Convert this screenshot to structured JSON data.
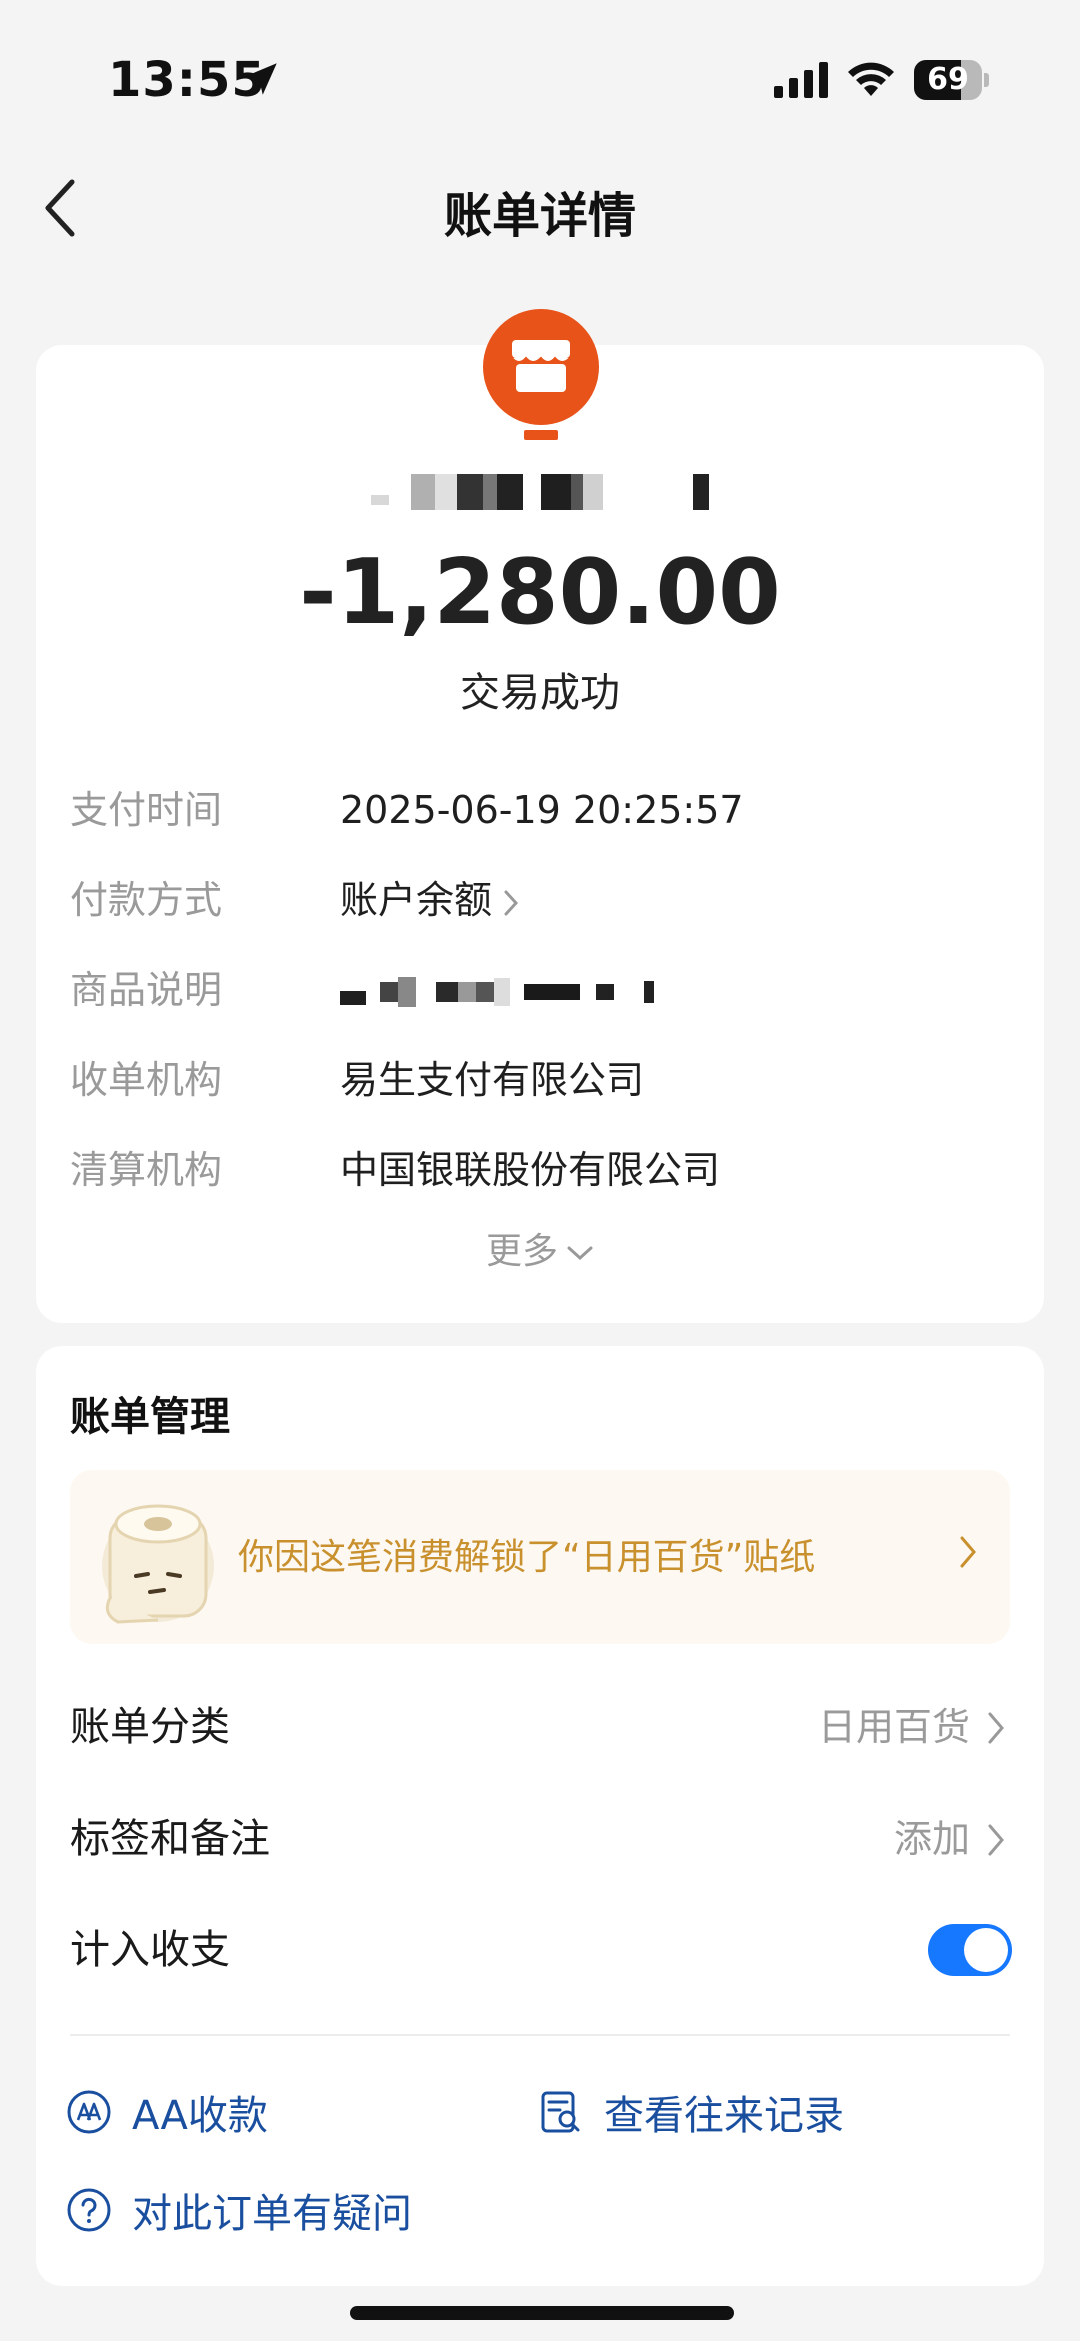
{
  "status_bar": {
    "time": "13:55",
    "battery": "69",
    "battery_level": 0.69
  },
  "nav": {
    "title": "账单详情"
  },
  "merchant": {
    "icon": "shop-icon",
    "brand_color": "#e8531a"
  },
  "transaction": {
    "amount": "-1,280.00",
    "status": "交易成功"
  },
  "details": [
    {
      "label": "支付时间",
      "value": "2025-06-19 20:25:57"
    },
    {
      "label": "付款方式",
      "value": "账户余额"
    },
    {
      "label": "商品说明",
      "value": ""
    },
    {
      "label": "收单机构",
      "value": "易生支付有限公司"
    },
    {
      "label": "清算机构",
      "value": "中国银联股份有限公司"
    }
  ],
  "more": {
    "label": "更多"
  },
  "management": {
    "title": "账单管理",
    "sticker_banner": {
      "text": "你因这笔消费解锁了“日用百货”贴纸"
    },
    "category": {
      "label": "账单分类",
      "value": "日用百货"
    },
    "tags": {
      "label": "标签和备注",
      "value": "添加"
    },
    "include_in_stats": {
      "label": "计入收支",
      "enabled": true
    },
    "actions": {
      "aa": "AA收款",
      "history": "查看往来记录",
      "question": "对此订单有疑问"
    }
  },
  "colors": {
    "accent": "#1677ff",
    "link": "#1a4fa0",
    "sticker_text": "#c9902e"
  }
}
